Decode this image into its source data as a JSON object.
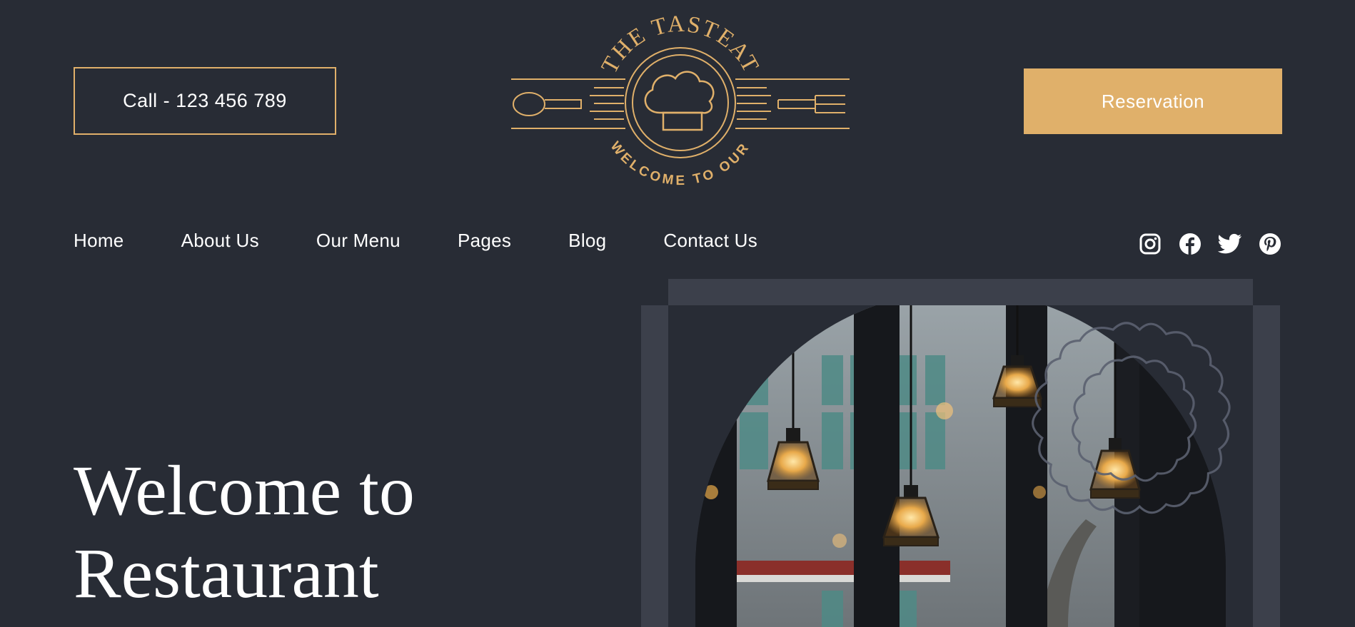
{
  "header": {
    "call_label": "Call - 123 456 789",
    "reservation_label": "Reservation",
    "logo": {
      "top_text": "THE TASTEAT",
      "bottom_text": "WELCOME TO OUR"
    }
  },
  "nav": {
    "items": [
      {
        "label": "Home"
      },
      {
        "label": "About Us"
      },
      {
        "label": "Our Menu"
      },
      {
        "label": "Pages"
      },
      {
        "label": "Blog"
      },
      {
        "label": "Contact Us"
      }
    ]
  },
  "social": [
    "instagram-icon",
    "facebook-icon",
    "twitter-icon",
    "pinterest-icon"
  ],
  "hero": {
    "title_line1": "Welcome to",
    "title_line2": "Restaurant"
  },
  "colors": {
    "background": "#282c35",
    "accent": "#e0b06a",
    "frame": "#3c404b"
  }
}
